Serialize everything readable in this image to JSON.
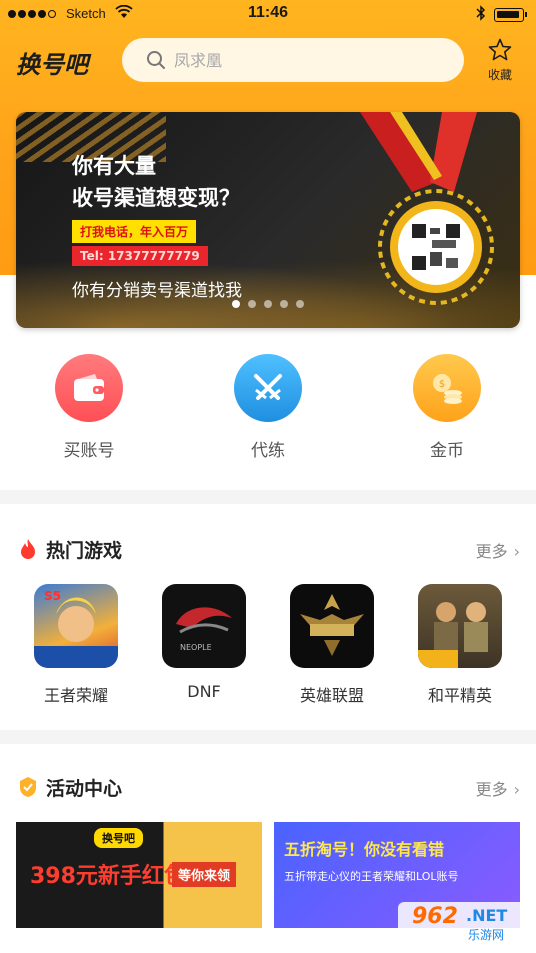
{
  "status_bar": {
    "carrier": "Sketch",
    "time": "11:46"
  },
  "header": {
    "logo": "换号吧",
    "search_placeholder": "凤求凰",
    "favorite_label": "收藏"
  },
  "banner": {
    "title_line1": "你有大量",
    "title_line2": "收号渠道想变现？",
    "tag1": "打我电话，年入百万",
    "tag2": "Tel: 17377777779",
    "subtitle": "你有分销卖号渠道找我",
    "dots_total": 5,
    "active_dot": 1
  },
  "quick_actions": [
    {
      "label": "买账号",
      "icon": "wallet-icon",
      "color": "#ff5a5f"
    },
    {
      "label": "代练",
      "icon": "crossed-swords-icon",
      "color": "#2ea6ee"
    },
    {
      "label": "金币",
      "icon": "coins-icon",
      "color": "#ffb12a"
    }
  ],
  "hot_games": {
    "title": "热门游戏",
    "more": "更多",
    "items": [
      {
        "name": "王者荣耀"
      },
      {
        "name": "DNF"
      },
      {
        "name": "英雄联盟"
      },
      {
        "name": "和平精英"
      }
    ]
  },
  "activity": {
    "title": "活动中心",
    "more": "更多",
    "cards": [
      {
        "tag": "换号吧",
        "headline": "398元新手红包",
        "badge": "等你来领"
      },
      {
        "headline": "五折淘号！你没有看错",
        "sub": "五折带走心仪的王者荣耀和LOL账号"
      }
    ]
  },
  "watermark": {
    "number": "962",
    "net": ".NET",
    "cn": "乐游网"
  },
  "colors": {
    "header_orange": "#ffa31a",
    "accent_red": "#ff5a5f",
    "accent_blue": "#2ea6ee",
    "accent_gold": "#ffb12a"
  }
}
